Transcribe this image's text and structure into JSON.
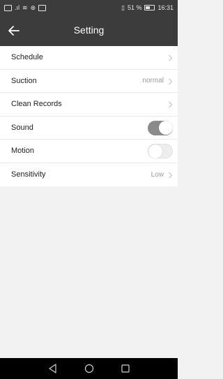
{
  "status_bar": {
    "battery_text": "51 %",
    "time": "16:31"
  },
  "header": {
    "title": "Setting"
  },
  "settings": {
    "items": [
      {
        "label": "Schedule",
        "value": "",
        "control": "chevron"
      },
      {
        "label": "Suction",
        "value": "normal",
        "control": "chevron"
      },
      {
        "label": "Clean Records",
        "value": "",
        "control": "chevron"
      },
      {
        "label": "Sound",
        "value": "",
        "control": "toggle",
        "state": "on"
      },
      {
        "label": "Motion",
        "value": "",
        "control": "toggle",
        "state": "off"
      },
      {
        "label": "Sensitivity",
        "value": "Low",
        "control": "chevron"
      }
    ]
  },
  "nav_bar": {
    "icons": [
      "back-triangle-icon",
      "home-circle-icon",
      "recents-square-icon"
    ]
  },
  "colors": {
    "app_bar": "#3c3c3c",
    "background": "#f2f2f2",
    "toggle_on": "#8a8a8a",
    "toggle_off": "#eeeeee"
  }
}
